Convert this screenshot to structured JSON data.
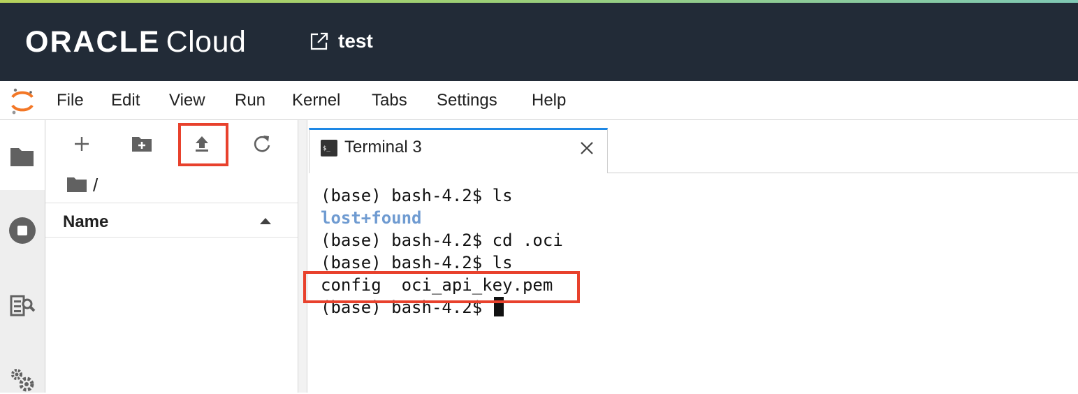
{
  "oracle_header": {
    "brand_oracle": "ORACLE",
    "brand_cloud": "Cloud",
    "notebook_title": "test",
    "background": "#222b37"
  },
  "menubar": {
    "items": [
      "File",
      "Edit",
      "View",
      "Run",
      "Kernel",
      "Tabs",
      "Settings",
      "Help"
    ]
  },
  "sidebar": {
    "icons": [
      "folder-icon",
      "running-stop-icon",
      "property-inspector-icon",
      "settings-gears-icon"
    ]
  },
  "file_browser": {
    "toolbar": [
      "new-launcher-icon",
      "new-folder-icon",
      "upload-icon",
      "refresh-icon"
    ],
    "breadcrumb": "/",
    "column_header": "Name"
  },
  "tabs": [
    {
      "label": "Terminal 3",
      "active": true
    }
  ],
  "terminal": {
    "lines": [
      "(base) bash-4.2$ ls",
      "lost+found",
      "(base) bash-4.2$ cd .oci",
      "(base) bash-4.2$ ls",
      "config  oci_api_key.pem",
      "(base) bash-4.2$ "
    ],
    "directory_color": "#6f9bd1"
  },
  "highlight_color": "#e8412c"
}
